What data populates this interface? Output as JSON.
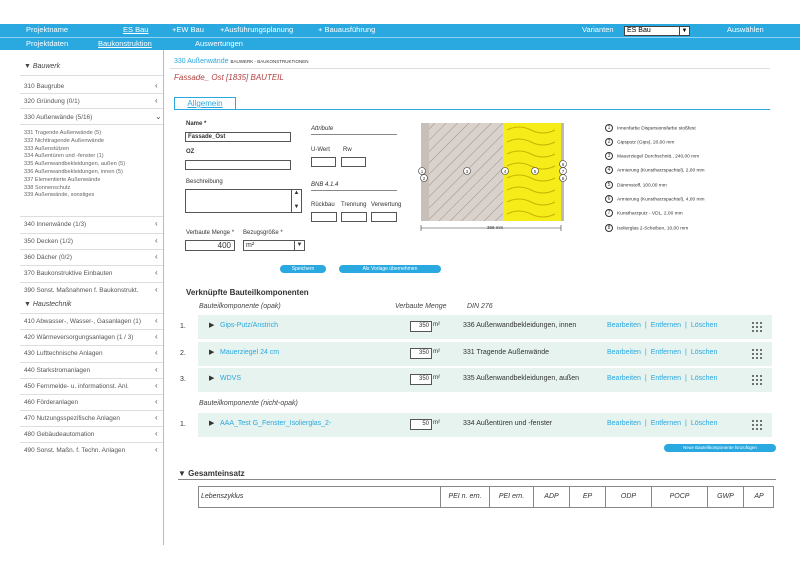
{
  "topbar": {
    "projektname": "Projektname",
    "es_bau": "ES Bau",
    "ew_bau": "+EW Bau",
    "ausfuehrungsplanung": "+Ausführungsplanung",
    "bauausfuehrung": "+ Bauausführung",
    "varianten_label": "Varianten",
    "variant_value": "ES Bau",
    "auswaehlen": "Auswählen",
    "projektdaten": "Projektdaten",
    "baukonstruktion": "Baukonstruktion",
    "auswertungen": "Auswertungen"
  },
  "sidebar": {
    "bauwerk_head": "Bauwerk",
    "items_top": [
      "310 Baugrube",
      "320 Gründung (0/1)",
      "330 Außenwände (5/16)"
    ],
    "sub_items": [
      "331 Tragende Außenwände (5)",
      "332 Nichttragende Außenwände",
      "333 Außenstützen",
      "334 Außentüren und -fenster (1)",
      "335 Außenwandbekleidungen, außen (5)",
      "336 Außenwandbekleidungen, innen (5)",
      "337 Elementierte Außenwände",
      "338 Sonnenschutz",
      "339 Außenwände, sonstiges"
    ],
    "items_mid": [
      "340 Innenwände (1/3)",
      "350 Decken (1/2)",
      "360 Dächer (0/2)",
      "370 Baukonstruktive Einbauten",
      "390 Sonst. Maßnahmen f. Baukonstrukt."
    ],
    "haustechnik_head": "Haustechnik",
    "items_ht": [
      "410 Abwasser-, Wasser-, Gasanlagen (1)",
      "420 Wärmeversorgungsanlagen (1 / 3)",
      "430 Lufttechnische Anlagen",
      "440 Starkstromanlagen",
      "450 Fernmelde- u. informationst. Anl.",
      "460 Förderanlagen",
      "470 Nutzungsspezifische Anlagen",
      "480 Gebäudeautomation",
      "490 Sonst. Maßn. f. Techn. Anlagen"
    ]
  },
  "main": {
    "breadcrumb": "330 Außenwände",
    "breadcrumb_suffix": "BAUWERK - BAUKONSTRUKTIONEN",
    "bauteil_title": "Fassade_ Ost [1835] BAUTEIL",
    "tab_allgemein": "Allgemein",
    "form": {
      "name_label": "Name *",
      "name_value": "Fassade_Ost",
      "oz_label": "OZ",
      "beschreibung_label": "Beschreibung",
      "verbaute_menge_label": "Verbaute Menge *",
      "verbaute_menge_value": "400",
      "bezugsgroesse_label": "Bezugsgröße *",
      "bezugsgroesse_value": "m²",
      "attribute_label": "Attribute",
      "uwert_label": "U-Wert",
      "rw_label": "Rw",
      "bnb_label": "BNB 4.1.4",
      "rueckbau_label": "Rückbau",
      "trennung_label": "Trennung",
      "verwertung_label": "Verwertung",
      "speichern": "Speichern",
      "als_vorlage": "Als Vorlage übernehmen"
    },
    "drawing": {
      "dimension": "368 mm"
    },
    "legend": [
      {
        "n": "1",
        "text": "Innenfarbe Dispersionsfarbe stoßfest"
      },
      {
        "n": "2",
        "text": "Gipsputz (Gips), 20,00 mm"
      },
      {
        "n": "3",
        "text": "Mauerziegel Durchschnitt., 240,00 mm"
      },
      {
        "n": "4",
        "text": "Armierung (Kunstharzspachtel), 2,00 mm"
      },
      {
        "n": "5",
        "text": "Dämmstoff, 100,00 mm"
      },
      {
        "n": "6",
        "text": "Armierung (Kunstharzspachtel), 4,00 mm"
      },
      {
        "n": "7",
        "text": "Kunstharzputz - VDL, 2,00 mm"
      },
      {
        "n": "8",
        "text": "Isolierglas 2-Scheiben, 10,00 mm"
      }
    ],
    "verknuepfte": {
      "heading": "Verknüpfte Bauteilkomponenten",
      "opak_label": "Bauteilkomponente (opak)",
      "verbaute_menge_col": "Verbaute Menge",
      "din_col": "DIN 276",
      "rows_opak": [
        {
          "num": "1.",
          "name": "Gips-Putz/Anstrich",
          "value": "350",
          "unit": "m²",
          "din": "336 Außenwandbekleidungen, innen"
        },
        {
          "num": "2.",
          "name": "Mauerziegel 24 cm",
          "value": "350",
          "unit": "m²",
          "din": "331 Tragende Außenwände"
        },
        {
          "num": "3.",
          "name": "WDVS",
          "value": "350",
          "unit": "m²",
          "din": "335 Außenwandbekleidungen, außen"
        }
      ],
      "nicht_opak_label": "Bauteilkomponente (nicht-opak)",
      "rows_nicht_opak": [
        {
          "num": "1.",
          "name": "AAA_Test G_Fenster_Isolierglas_2-",
          "value": "50",
          "unit": "m²",
          "din": "334 Außentüren und -fenster"
        }
      ],
      "actions": {
        "edit": "Bearbeiten",
        "remove": "Entfernen",
        "delete": "Löschen"
      },
      "new_button": "Neue Bauteilkomponente hinzufügen"
    },
    "gesamteinsatz": {
      "heading": "Gesamteinsatz",
      "columns": [
        "Lebenszyklus",
        "PEI n. ern.",
        "PEI ern.",
        "ADP",
        "EP",
        "ODP",
        "POCP",
        "GWP",
        "AP"
      ]
    }
  }
}
